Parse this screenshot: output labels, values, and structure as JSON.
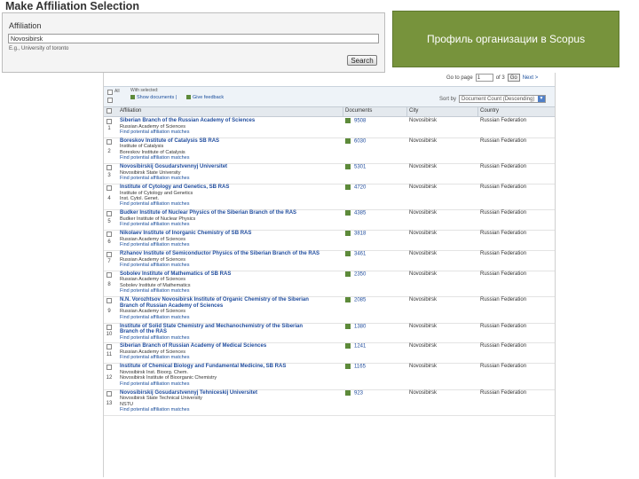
{
  "page_title": "Make Affiliation Selection",
  "affiliation": {
    "label": "Affiliation",
    "value": "Novosibirsk",
    "example": "E.g., University of toronto",
    "search_label": "Search"
  },
  "callout": "Профиль организации в Scopus",
  "pager": {
    "goto_label": "Go to page",
    "page": "1",
    "of_label": "of 3",
    "go_label": "Go",
    "next_label": "Next >"
  },
  "toolbar": {
    "all_label": "All",
    "with_selected": "With selected:",
    "show_documents": "Show documents",
    "separator": "|",
    "give_feedback": "Give feedback",
    "sort_label": "Sort by",
    "sort_value": "Document Count (Descending)"
  },
  "columns": {
    "affiliation": "Affiliation",
    "documents": "Documents",
    "city": "City",
    "country": "Country"
  },
  "rows": [
    {
      "num": "1",
      "name": [
        "Siberian Branch of the Russian Academy of Sciences"
      ],
      "subs": [
        "Russian Academy of Sciences"
      ],
      "link": "Find potential affiliation matches",
      "docs": "9508",
      "city": "Novosibirsk",
      "country": "Russian Federation"
    },
    {
      "num": "2",
      "name": [
        "Boreskov Institute of Catalysis SB RAS"
      ],
      "subs": [
        "Institute of Catalysis",
        "Boreskov Institute of Catalysis"
      ],
      "link": "Find potential affiliation matches",
      "docs": "6030",
      "city": "Novosibirsk",
      "country": "Russian Federation"
    },
    {
      "num": "3",
      "name": [
        "Novosibirskij Gosudarstvennyj Universitet"
      ],
      "subs": [
        "Novosibirsk State University"
      ],
      "link": "Find potential affiliation matches",
      "docs": "5301",
      "city": "Novosibirsk",
      "country": "Russian Federation"
    },
    {
      "num": "4",
      "name": [
        "Institute of Cytology and Genetics, SB RAS"
      ],
      "subs": [
        "Institute of Cytology and Genetics",
        "Inst. Cytol. Genet."
      ],
      "link": "Find potential affiliation matches",
      "docs": "4720",
      "city": "Novosibirsk",
      "country": "Russian Federation"
    },
    {
      "num": "5",
      "name": [
        "Budker Institute of Nuclear Physics of the Siberian Branch of the RAS"
      ],
      "subs": [
        "Budker Institute of Nuclear Physics"
      ],
      "link": "Find potential affiliation matches",
      "docs": "4385",
      "city": "Novosibirsk",
      "country": "Russian Federation"
    },
    {
      "num": "6",
      "name": [
        "Nikolaev Institute of Inorganic Chemistry of SB RAS"
      ],
      "subs": [
        "Russian Academy of Sciences"
      ],
      "link": "Find potential affiliation matches",
      "docs": "3818",
      "city": "Novosibirsk",
      "country": "Russian Federation"
    },
    {
      "num": "7",
      "name": [
        "Rzhanov Institute of Semiconductor Physics of the Siberian Branch of the RAS"
      ],
      "subs": [
        "Russian Academy of Sciences"
      ],
      "link": "Find potential affiliation matches",
      "docs": "3461",
      "city": "Novosibirsk",
      "country": "Russian Federation"
    },
    {
      "num": "8",
      "name": [
        "Sobolev Institute of Mathematics of SB RAS"
      ],
      "subs": [
        "Russian Academy of Sciences",
        "Sobolev Institute of Mathematics"
      ],
      "link": "Find potential affiliation matches",
      "docs": "2350",
      "city": "Novosibirsk",
      "country": "Russian Federation"
    },
    {
      "num": "9",
      "name": [
        "N.N. Vorozhtsov Novosibirsk Institute of Organic Chemistry of the Siberian",
        "Branch of Russian Academy of Sciences"
      ],
      "subs": [
        "Russian Academy of Sciences"
      ],
      "link": "Find potential affiliation matches",
      "docs": "2085",
      "city": "Novosibirsk",
      "country": "Russian Federation"
    },
    {
      "num": "10",
      "name": [
        "Institute of Solid State Chemistry and Mechanochemistry of the Siberian",
        "Branch of the RAS"
      ],
      "subs": [],
      "link": "Find potential affiliation matches",
      "docs": "1380",
      "city": "Novosibirsk",
      "country": "Russian Federation"
    },
    {
      "num": "11",
      "name": [
        "Siberian Branch of Russian Academy of Medical Sciences"
      ],
      "subs": [
        "Russian Academy of Sciences"
      ],
      "link": "Find potential affiliation matches",
      "docs": "1241",
      "city": "Novosibirsk",
      "country": "Russian Federation"
    },
    {
      "num": "12",
      "name": [
        "Institute of Chemical Biology and Fundamental Medicine, SB RAS"
      ],
      "subs": [
        "Novosibirsk Inst. Bioorg. Chem.",
        "Novosibirsk Institute of Bioorganic Chemistry"
      ],
      "link": "Find potential affiliation matches",
      "docs": "1165",
      "city": "Novosibirsk",
      "country": "Russian Federation"
    },
    {
      "num": "13",
      "name": [
        "Novosibirskij Gosudarstvennyj Tehniceskij Universitet"
      ],
      "subs": [
        "Novosibirsk State Technical University",
        "NSTU"
      ],
      "link": "Find potential affiliation matches",
      "docs": "923",
      "city": "Novosibirsk",
      "country": "Russian Federation"
    }
  ]
}
